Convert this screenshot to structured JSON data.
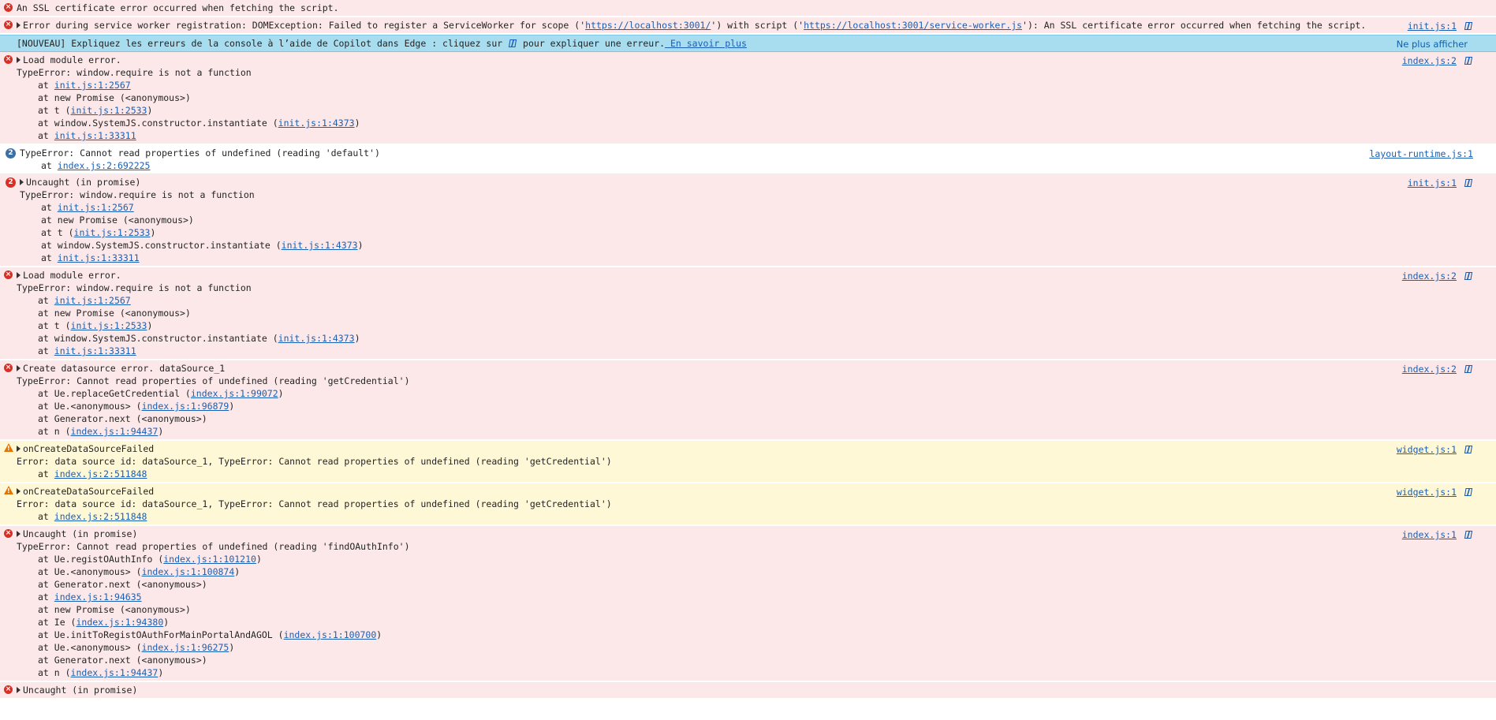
{
  "messages": [
    {
      "level": "error",
      "lines": [
        {
          "text": "An SSL certificate error occurred when fetching the script."
        }
      ]
    },
    {
      "level": "error",
      "expandable": true,
      "source": "init.js:1",
      "lines": [
        {
          "parts": [
            {
              "t": "Error during service worker registration: DOMException: Failed to register a ServiceWorker for scope ('"
            },
            {
              "t": "https://localhost:3001/",
              "link": true
            },
            {
              "t": "') with script ('"
            },
            {
              "t": "https://localhost:3001/service-worker.js",
              "link": true
            },
            {
              "t": "'): An SSL certificate error occurred when fetching the script."
            }
          ]
        }
      ]
    },
    {
      "level": "banner",
      "banner": true
    },
    {
      "level": "error",
      "expandable": true,
      "source": "index.js:2",
      "lines": [
        {
          "text": "Load module error."
        },
        {
          "text": "TypeError: window.require is not a function",
          "cont": true
        },
        {
          "trace": true,
          "parts": [
            {
              "t": "at "
            },
            {
              "t": "init.js:1:2567",
              "link": true
            }
          ]
        },
        {
          "trace": true,
          "parts": [
            {
              "t": "at new Promise (<anonymous>)"
            }
          ]
        },
        {
          "trace": true,
          "parts": [
            {
              "t": "at t ("
            },
            {
              "t": "init.js:1:2533",
              "link": true
            },
            {
              "t": ")"
            }
          ]
        },
        {
          "trace": true,
          "parts": [
            {
              "t": "at window.SystemJS.constructor.instantiate ("
            },
            {
              "t": "init.js:1:4373",
              "link": true
            },
            {
              "t": ")"
            }
          ]
        },
        {
          "trace": true,
          "parts": [
            {
              "t": "at "
            },
            {
              "t": "init.js:1:33311",
              "link": true
            }
          ]
        }
      ]
    },
    {
      "level": "info",
      "count": "2",
      "countColor": "#3b6fa8",
      "source": "layout-runtime.js:1",
      "nocopilot": true,
      "lines": [
        {
          "text": "TypeError: Cannot read properties of undefined (reading 'default')"
        },
        {
          "trace": true,
          "parts": [
            {
              "t": "at "
            },
            {
              "t": "index.js:2:692225",
              "link": true
            }
          ]
        }
      ]
    },
    {
      "level": "error",
      "count": "2",
      "countColor": "#d93025",
      "expandable": true,
      "source": "init.js:1",
      "lines": [
        {
          "text": "Uncaught (in promise)"
        },
        {
          "text": "TypeError: window.require is not a function",
          "cont": true
        },
        {
          "trace": true,
          "parts": [
            {
              "t": "at "
            },
            {
              "t": "init.js:1:2567",
              "link": true
            }
          ]
        },
        {
          "trace": true,
          "parts": [
            {
              "t": "at new Promise (<anonymous>)"
            }
          ]
        },
        {
          "trace": true,
          "parts": [
            {
              "t": "at t ("
            },
            {
              "t": "init.js:1:2533",
              "link": true
            },
            {
              "t": ")"
            }
          ]
        },
        {
          "trace": true,
          "parts": [
            {
              "t": "at window.SystemJS.constructor.instantiate ("
            },
            {
              "t": "init.js:1:4373",
              "link": true
            },
            {
              "t": ")"
            }
          ]
        },
        {
          "trace": true,
          "parts": [
            {
              "t": "at "
            },
            {
              "t": "init.js:1:33311",
              "link": true
            }
          ]
        }
      ]
    },
    {
      "level": "error",
      "expandable": true,
      "source": "index.js:2",
      "lines": [
        {
          "text": "Load module error."
        },
        {
          "text": "TypeError: window.require is not a function",
          "cont": true
        },
        {
          "trace": true,
          "parts": [
            {
              "t": "at "
            },
            {
              "t": "init.js:1:2567",
              "link": true
            }
          ]
        },
        {
          "trace": true,
          "parts": [
            {
              "t": "at new Promise (<anonymous>)"
            }
          ]
        },
        {
          "trace": true,
          "parts": [
            {
              "t": "at t ("
            },
            {
              "t": "init.js:1:2533",
              "link": true
            },
            {
              "t": ")"
            }
          ]
        },
        {
          "trace": true,
          "parts": [
            {
              "t": "at window.SystemJS.constructor.instantiate ("
            },
            {
              "t": "init.js:1:4373",
              "link": true
            },
            {
              "t": ")"
            }
          ]
        },
        {
          "trace": true,
          "parts": [
            {
              "t": "at "
            },
            {
              "t": "init.js:1:33311",
              "link": true
            }
          ]
        }
      ]
    },
    {
      "level": "error",
      "expandable": true,
      "source": "index.js:2",
      "lines": [
        {
          "text": "Create datasource error. dataSource_1"
        },
        {
          "text": "TypeError: Cannot read properties of undefined (reading 'getCredential')",
          "cont": true
        },
        {
          "trace": true,
          "parts": [
            {
              "t": "at Ue.replaceGetCredential ("
            },
            {
              "t": "index.js:1:99072",
              "link": true
            },
            {
              "t": ")"
            }
          ]
        },
        {
          "trace": true,
          "parts": [
            {
              "t": "at Ue.<anonymous> ("
            },
            {
              "t": "index.js:1:96879",
              "link": true
            },
            {
              "t": ")"
            }
          ]
        },
        {
          "trace": true,
          "parts": [
            {
              "t": "at Generator.next (<anonymous>)"
            }
          ]
        },
        {
          "trace": true,
          "parts": [
            {
              "t": "at n ("
            },
            {
              "t": "index.js:1:94437",
              "link": true
            },
            {
              "t": ")"
            }
          ]
        }
      ]
    },
    {
      "level": "warning",
      "expandable": true,
      "source": "widget.js:1",
      "lines": [
        {
          "text": "onCreateDataSourceFailed"
        },
        {
          "text": "Error: data source id: dataSource_1, TypeError: Cannot read properties of undefined (reading 'getCredential')",
          "cont": true
        },
        {
          "trace": true,
          "parts": [
            {
              "t": "at "
            },
            {
              "t": "index.js:2:511848",
              "link": true
            }
          ]
        }
      ]
    },
    {
      "level": "warning",
      "expandable": true,
      "source": "widget.js:1",
      "lines": [
        {
          "text": "onCreateDataSourceFailed"
        },
        {
          "text": "Error: data source id: dataSource_1, TypeError: Cannot read properties of undefined (reading 'getCredential')",
          "cont": true
        },
        {
          "trace": true,
          "parts": [
            {
              "t": "at "
            },
            {
              "t": "index.js:2:511848",
              "link": true
            }
          ]
        }
      ]
    },
    {
      "level": "error",
      "expandable": true,
      "source": "index.js:1",
      "lines": [
        {
          "text": "Uncaught (in promise)"
        },
        {
          "text": "TypeError: Cannot read properties of undefined (reading 'findOAuthInfo')",
          "cont": true
        },
        {
          "trace": true,
          "parts": [
            {
              "t": "at Ue.registOAuthInfo ("
            },
            {
              "t": "index.js:1:101210",
              "link": true
            },
            {
              "t": ")"
            }
          ]
        },
        {
          "trace": true,
          "parts": [
            {
              "t": "at Ue.<anonymous> ("
            },
            {
              "t": "index.js:1:100874",
              "link": true
            },
            {
              "t": ")"
            }
          ]
        },
        {
          "trace": true,
          "parts": [
            {
              "t": "at Generator.next (<anonymous>)"
            }
          ]
        },
        {
          "trace": true,
          "parts": [
            {
              "t": "at "
            },
            {
              "t": "index.js:1:94635",
              "link": true
            }
          ]
        },
        {
          "trace": true,
          "parts": [
            {
              "t": "at new Promise (<anonymous>)"
            }
          ]
        },
        {
          "trace": true,
          "parts": [
            {
              "t": "at Ie ("
            },
            {
              "t": "index.js:1:94380",
              "link": true
            },
            {
              "t": ")"
            }
          ]
        },
        {
          "trace": true,
          "parts": [
            {
              "t": "at Ue.initToRegistOAuthForMainPortalAndAGOL ("
            },
            {
              "t": "index.js:1:100700",
              "link": true
            },
            {
              "t": ")"
            }
          ]
        },
        {
          "trace": true,
          "parts": [
            {
              "t": "at Ue.<anonymous> ("
            },
            {
              "t": "index.js:1:96275",
              "link": true
            },
            {
              "t": ")"
            }
          ]
        },
        {
          "trace": true,
          "parts": [
            {
              "t": "at Generator.next (<anonymous>)"
            }
          ]
        },
        {
          "trace": true,
          "parts": [
            {
              "t": "at n ("
            },
            {
              "t": "index.js:1:94437",
              "link": true
            },
            {
              "t": ")"
            }
          ]
        }
      ]
    },
    {
      "level": "error",
      "expandable": true,
      "source": "",
      "lines": [
        {
          "text": "Uncaught (in promise)"
        }
      ]
    }
  ],
  "banner": {
    "prefix": "[NOUVEAU] Expliquez les erreurs de la console à l’aide de Copilot dans Edge : cliquez sur ",
    "suffix": " pour expliquer une erreur.",
    "link": " En savoir plus",
    "action": "Ne plus afficher"
  },
  "icons": {
    "error": "error-circle-icon",
    "warning": "warning-triangle-icon",
    "copilot": "copilot-icon"
  },
  "colors": {
    "error_bg": "#fce8e8",
    "warning_bg": "#fff8d6",
    "banner_bg": "#a8dcef",
    "link": "#1a5fb4"
  }
}
